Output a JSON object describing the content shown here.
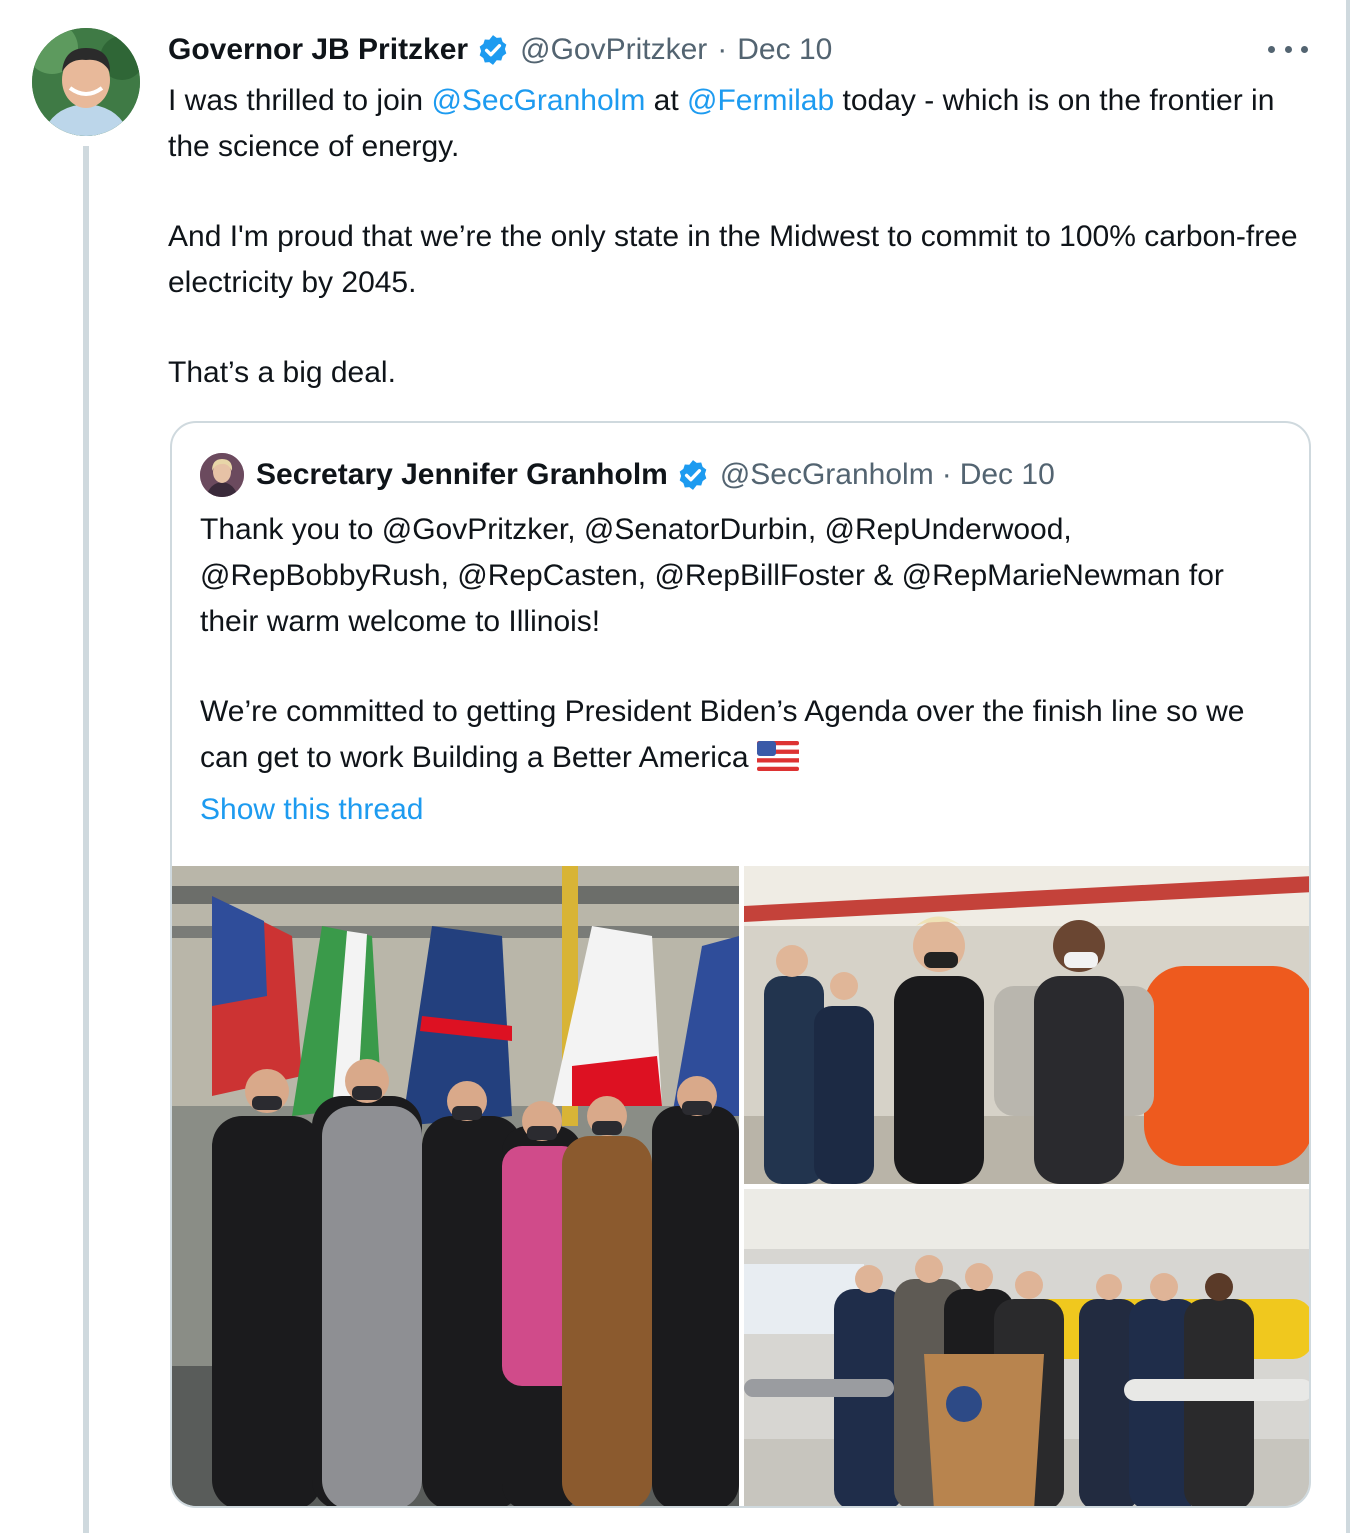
{
  "tweet": {
    "author_name": "Governor JB Pritzker",
    "author_handle": "@GovPritzker",
    "separator": "·",
    "date": "Dec 10",
    "text": {
      "line1_a": "I was thrilled to join ",
      "mention1": "@SecGranholm",
      "line1_b": " at ",
      "mention2": "@Fermilab",
      "line1_c": " today - which is on the frontier in the science of energy.",
      "para2": "And I'm proud that we’re the only state in the Midwest to commit to 100% carbon-free electricity by 2045.",
      "para3": "That’s a big deal."
    },
    "verified_icon": "verified-badge-icon",
    "more_icon": "more-options-icon"
  },
  "quoted": {
    "author_name": "Secretary Jennifer Granholm",
    "author_handle": "@SecGranholm",
    "separator": "·",
    "date": "Dec 10",
    "para1": "Thank you to @GovPritzker, @SenatorDurbin, @RepUnderwood, @RepBobbyRush, @RepCasten, @RepBillFoster & @RepMarieNewman for their warm welcome to Illinois!",
    "para2": "We’re committed to getting President Biden’s Agenda over the finish line so we can get to work Building a Better America",
    "emoji": "us-flag-emoji",
    "show_thread": "Show this thread"
  },
  "colors": {
    "link": "#1d9bf0",
    "secondary_text": "#536471",
    "border": "#cfd9de",
    "verified": "#1d9bf0"
  }
}
